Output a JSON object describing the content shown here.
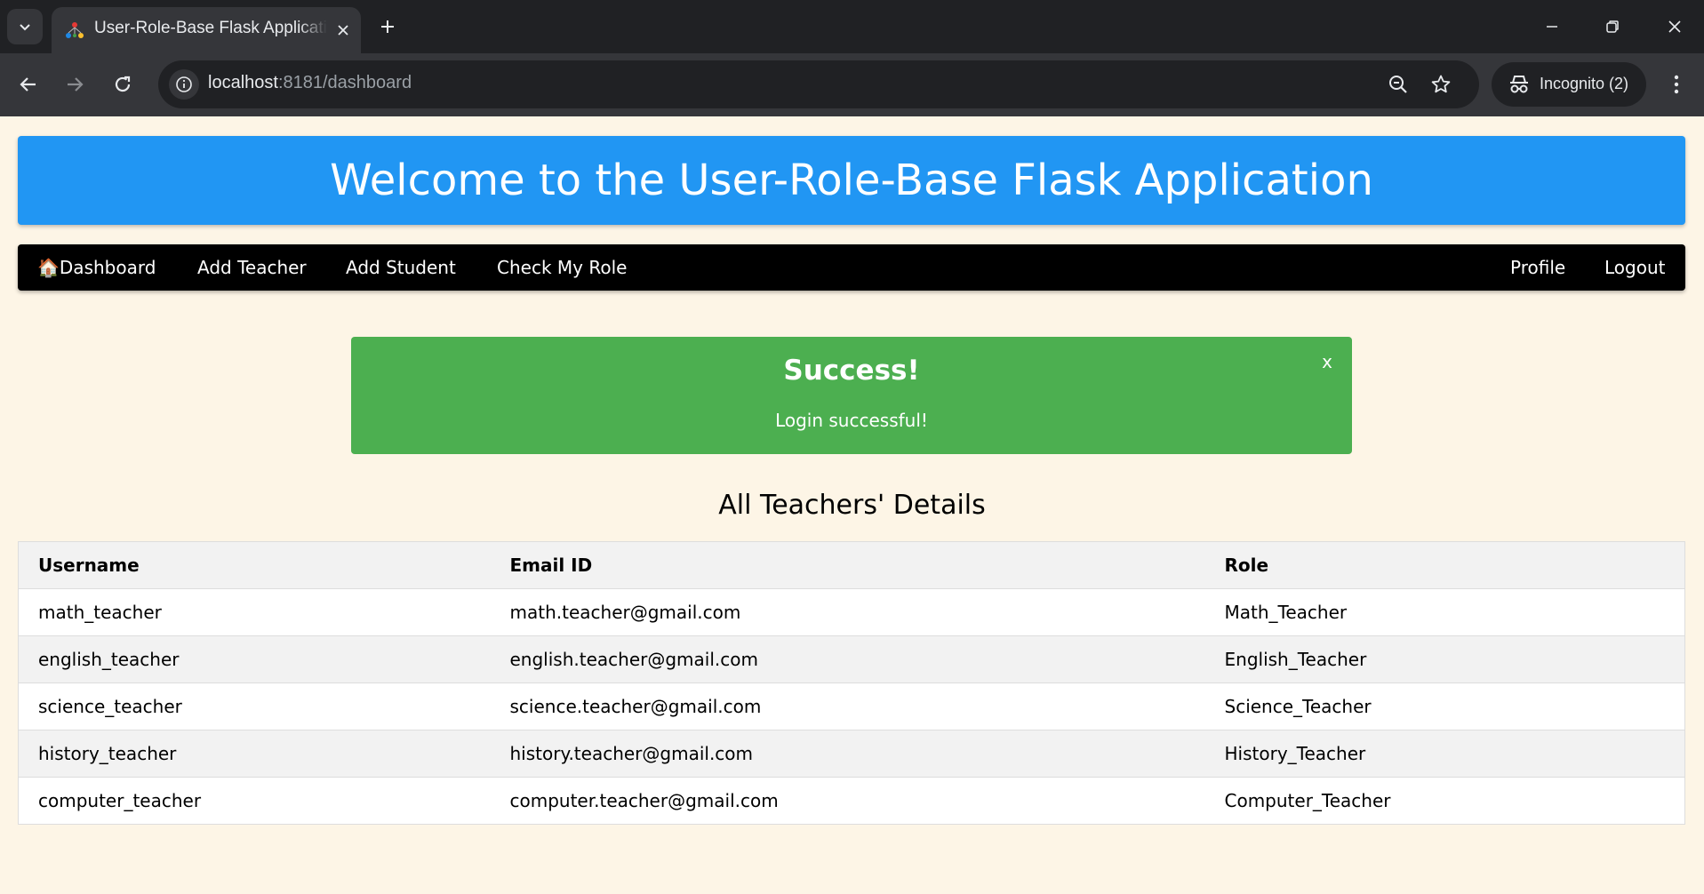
{
  "browser": {
    "tab_title": "User-Role-Base Flask Application",
    "url_host": "localhost",
    "url_rest": ":8181/dashboard",
    "incognito_label": "Incognito (2)"
  },
  "header": {
    "title": "Welcome to the User-Role-Base Flask Application"
  },
  "navbar": {
    "left": [
      {
        "icon": "🏠",
        "label": "Dashboard"
      },
      {
        "label": "Add Teacher"
      },
      {
        "label": "Add Student"
      },
      {
        "label": "Check My Role"
      }
    ],
    "right": [
      {
        "label": "Profile"
      },
      {
        "label": "Logout"
      }
    ]
  },
  "alert": {
    "title": "Success!",
    "message": "Login successful!",
    "close": "x",
    "color": "#4caf50"
  },
  "teachers": {
    "title": "All Teachers' Details",
    "columns": [
      "Username",
      "Email ID",
      "Role"
    ],
    "rows": [
      [
        "math_teacher",
        "math.teacher@gmail.com",
        "Math_Teacher"
      ],
      [
        "english_teacher",
        "english.teacher@gmail.com",
        "English_Teacher"
      ],
      [
        "science_teacher",
        "science.teacher@gmail.com",
        "Science_Teacher"
      ],
      [
        "history_teacher",
        "history.teacher@gmail.com",
        "History_Teacher"
      ],
      [
        "computer_teacher",
        "computer.teacher@gmail.com",
        "Computer_Teacher"
      ]
    ]
  },
  "colors": {
    "header_bg": "#2196f3",
    "navbar_bg": "#000000",
    "page_bg": "#fdf5e6"
  }
}
